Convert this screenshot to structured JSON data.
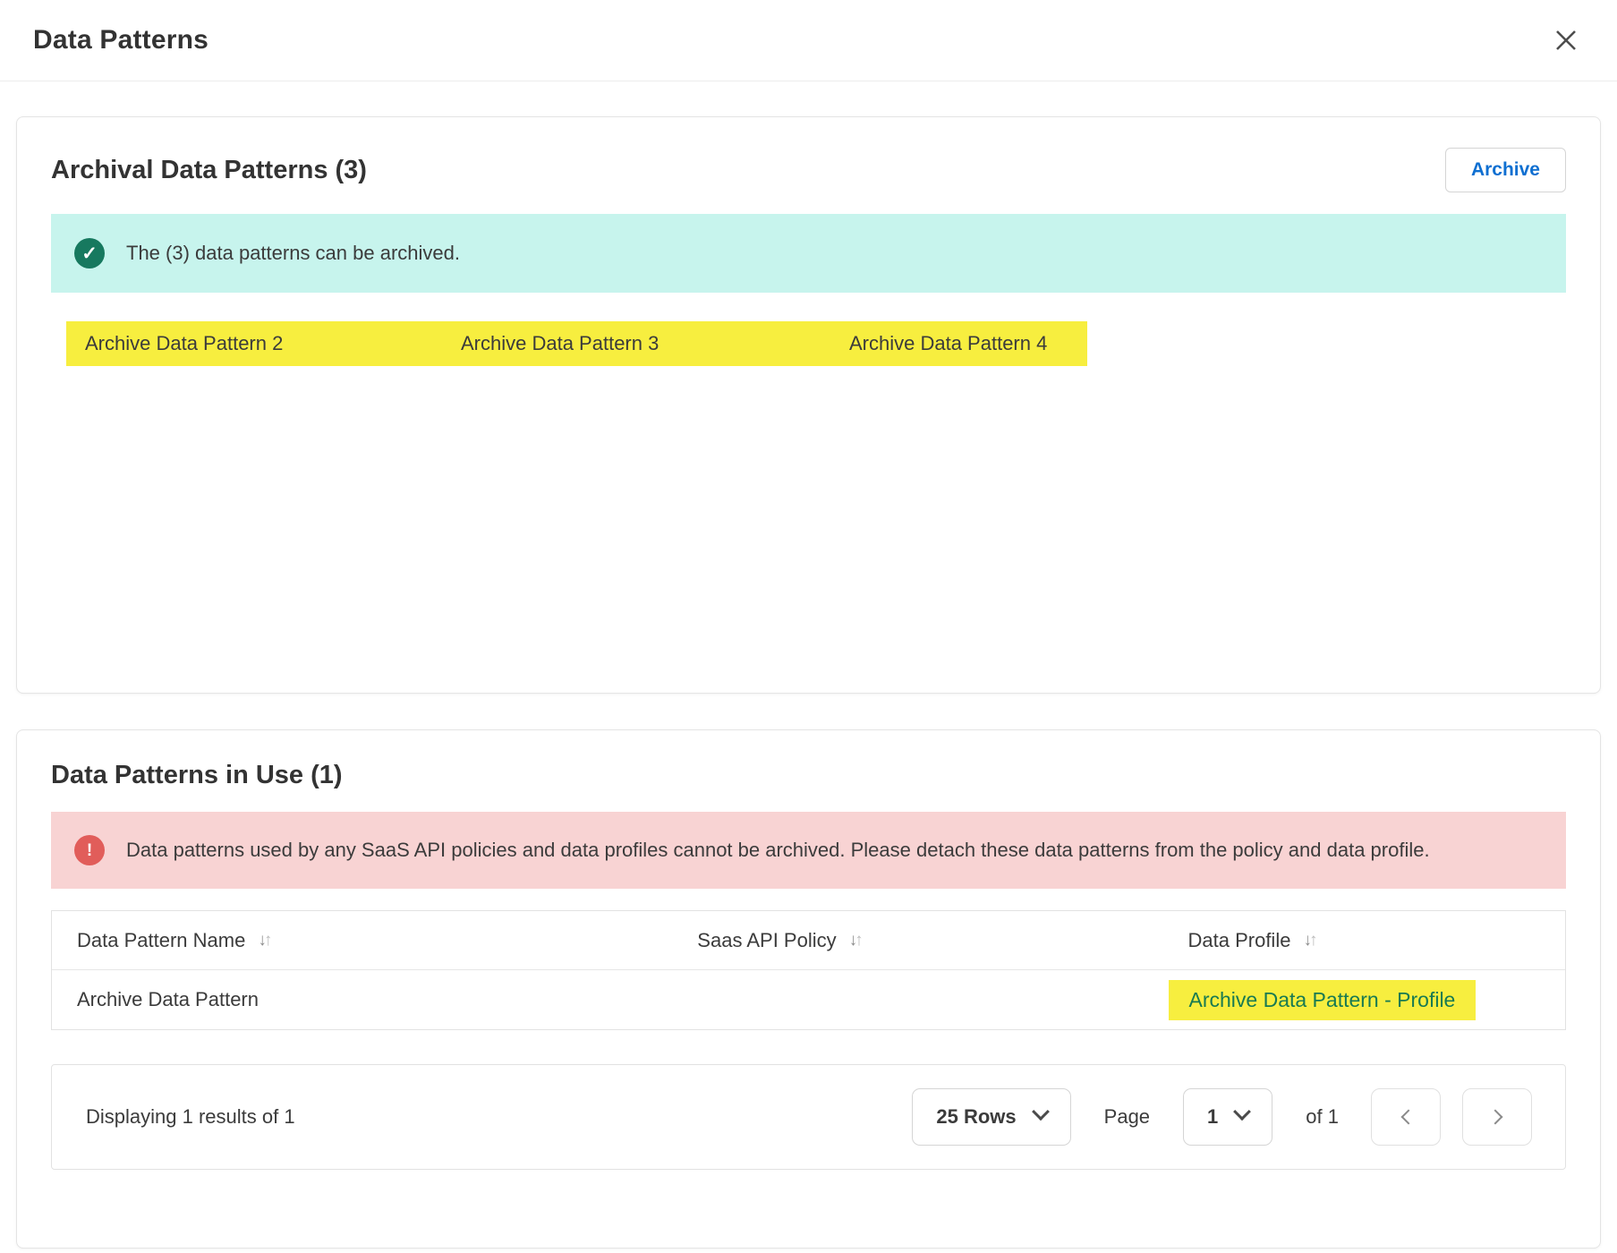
{
  "dialog": {
    "title": "Data Patterns"
  },
  "icons": {
    "close": "✕",
    "check": "✓",
    "alert": "!",
    "sort_down": "↓",
    "sort_up": "↑"
  },
  "archival_section": {
    "title": "Archival Data Patterns (3)",
    "archive_button_label": "Archive",
    "banner_text": "The (3) data patterns can be archived.",
    "patterns": [
      "Archive Data Pattern 2",
      "Archive Data Pattern 3",
      "Archive Data Pattern 4"
    ]
  },
  "in_use_section": {
    "title": "Data Patterns in Use (1)",
    "banner_text": "Data patterns used by any SaaS API policies and data profiles cannot be archived. Please detach these data patterns from the policy and data profile.",
    "table": {
      "columns": [
        "Data Pattern Name",
        "Saas API Policy",
        "Data Profile"
      ],
      "rows": [
        {
          "name": "Archive Data Pattern",
          "policy": "",
          "profile": "Archive Data Pattern - Profile"
        }
      ]
    },
    "pagination": {
      "summary": "Displaying 1 results of 1",
      "rows_selector_label": "25 Rows",
      "page_label": "Page",
      "page_value": "1",
      "of_label": "of 1"
    }
  },
  "colors": {
    "accent_blue": "#0e6fd1",
    "success_banner_bg": "#c7f4ed",
    "success_icon": "#17795f",
    "error_banner_bg": "#f8d3d3",
    "error_icon": "#e15d5a",
    "highlight_yellow": "#f7ee3f",
    "profile_link_green": "#187a52"
  }
}
